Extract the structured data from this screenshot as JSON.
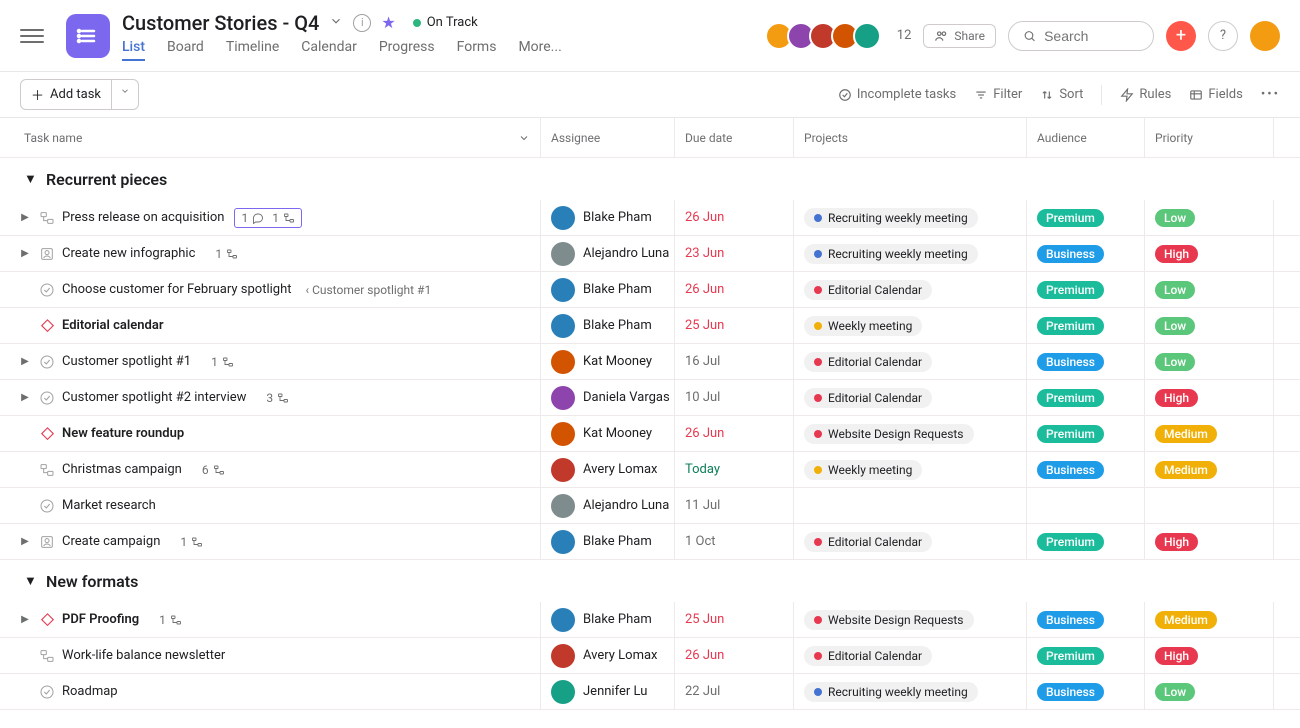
{
  "header": {
    "title": "Customer Stories - Q4",
    "status": {
      "label": "On Track",
      "color": "#2cb67d"
    },
    "facepile_count": "12",
    "share_label": "Share",
    "search_placeholder": "Search",
    "facepile_colors": [
      "#f39c12",
      "#8e44ad",
      "#c0392b",
      "#d35400",
      "#16a085"
    ],
    "add_circle_color": "#ff584a"
  },
  "tabs": [
    "List",
    "Board",
    "Timeline",
    "Calendar",
    "Progress",
    "Forms",
    "More..."
  ],
  "active_tab": "List",
  "toolbar": {
    "add_task": "Add task",
    "completion_filter": "Incomplete tasks",
    "filter": "Filter",
    "sort": "Sort",
    "rules": "Rules",
    "fields": "Fields"
  },
  "columns": {
    "name": "Task name",
    "assignee": "Assignee",
    "duedate": "Due date",
    "projects": "Projects",
    "audience": "Audience",
    "priority": "Priority"
  },
  "avatar_colors": {
    "Blake Pham": "#2980b9",
    "Alejandro Luna": "#7f8c8d",
    "Kat Mooney": "#d35400",
    "Daniela Vargas": "#8e44ad",
    "Avery Lomax": "#c0392b",
    "Jennifer Lu": "#16a085"
  },
  "sections": [
    {
      "title": "Recurrent pieces",
      "tasks": [
        {
          "icon": "subtasks",
          "expand": true,
          "title": "Press release on acquisition",
          "comments": "1",
          "subtasks": "1",
          "highlightMeta": true,
          "assignee": "Blake Pham",
          "due": "26 Jun",
          "due_style": "overdue",
          "project": {
            "label": "Recruiting weekly meeting",
            "dot": "#4573d2"
          },
          "audience": "Premium",
          "priority": "Low"
        },
        {
          "icon": "approval",
          "expand": true,
          "title": "Create new infographic",
          "subtasks": "1",
          "assignee": "Alejandro Luna",
          "due": "23 Jun",
          "due_style": "overdue",
          "project": {
            "label": "Recruiting weekly meeting",
            "dot": "#4573d2"
          },
          "audience": "Business",
          "priority": "High"
        },
        {
          "icon": "circle",
          "title": "Choose customer for February spotlight",
          "breadcrumb": "‹ Customer spotlight #1",
          "assignee": "Blake Pham",
          "due": "26 Jun",
          "due_style": "overdue",
          "project": {
            "label": "Editorial Calendar",
            "dot": "#e8384f"
          },
          "audience": "Premium",
          "priority": "Low"
        },
        {
          "icon": "milestone",
          "bold": true,
          "title": "Editorial calendar",
          "assignee": "Blake Pham",
          "due": "25 Jun",
          "due_style": "overdue",
          "project": {
            "label": "Weekly meeting",
            "dot": "#f1b007"
          },
          "audience": "Premium",
          "priority": "Low"
        },
        {
          "icon": "circle",
          "expand": true,
          "title": "Customer spotlight #1",
          "subtasks": "1",
          "assignee": "Kat Mooney",
          "due": "16 Jul",
          "due_style": "future",
          "project": {
            "label": "Editorial Calendar",
            "dot": "#e8384f"
          },
          "audience": "Business",
          "priority": "Low"
        },
        {
          "icon": "circle",
          "expand": true,
          "title": "Customer spotlight #2 interview",
          "subtasks": "3",
          "assignee": "Daniela Vargas",
          "due": "10 Jul",
          "due_style": "future",
          "project": {
            "label": "Editorial Calendar",
            "dot": "#e8384f"
          },
          "audience": "Premium",
          "priority": "High"
        },
        {
          "icon": "milestone",
          "bold": true,
          "title": "New feature roundup",
          "assignee": "Kat Mooney",
          "due": "26 Jun",
          "due_style": "overdue",
          "project": {
            "label": "Website Design Requests",
            "dot": "#e8384f"
          },
          "audience": "Premium",
          "priority": "Medium"
        },
        {
          "icon": "subtasks",
          "title": "Christmas campaign",
          "subtasks": "6",
          "assignee": "Avery Lomax",
          "due": "Today",
          "due_style": "today",
          "project": {
            "label": "Weekly meeting",
            "dot": "#f1b007"
          },
          "audience": "Business",
          "priority": "Medium"
        },
        {
          "icon": "circle",
          "title": "Market research",
          "assignee": "Alejandro Luna",
          "due": "11 Jul",
          "due_style": "future"
        },
        {
          "icon": "approval",
          "expand": true,
          "title": "Create campaign",
          "subtasks": "1",
          "assignee": "Blake Pham",
          "due": "1 Oct",
          "due_style": "future",
          "project": {
            "label": "Editorial Calendar",
            "dot": "#e8384f"
          },
          "audience": "Premium",
          "priority": "High"
        }
      ]
    },
    {
      "title": "New formats",
      "tasks": [
        {
          "icon": "milestone",
          "expand": true,
          "bold": true,
          "title": "PDF Proofing",
          "subtasks": "1",
          "assignee": "Blake Pham",
          "due": "25 Jun",
          "due_style": "overdue",
          "project": {
            "label": "Website Design Requests",
            "dot": "#e8384f"
          },
          "audience": "Business",
          "priority": "Medium"
        },
        {
          "icon": "subtasks",
          "title": "Work-life balance newsletter",
          "assignee": "Avery Lomax",
          "due": "26 Jun",
          "due_style": "overdue",
          "project": {
            "label": "Editorial Calendar",
            "dot": "#e8384f"
          },
          "audience": "Premium",
          "priority": "High"
        },
        {
          "icon": "circle",
          "title": "Roadmap",
          "assignee": "Jennifer Lu",
          "due": "22 Jul",
          "due_style": "future",
          "project": {
            "label": "Recruiting weekly meeting",
            "dot": "#4573d2"
          },
          "audience": "Business",
          "priority": "Low"
        }
      ]
    }
  ]
}
